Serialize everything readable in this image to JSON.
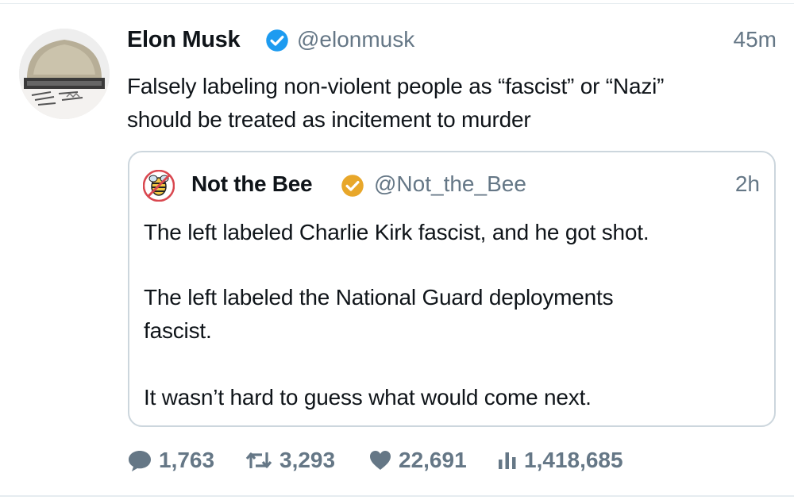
{
  "tweet": {
    "author_name": "Elon Musk",
    "author_handle": "@elonmusk",
    "time": "45m",
    "text_line1": "Falsely labeling non-violent people as “fascist” or “Nazi”",
    "text_line2": "should be treated as incitement to murder",
    "verified_color": "#1d9bf0"
  },
  "quoted_tweet": {
    "author_name": "Not the Bee",
    "author_handle": "@Not_the_Bee",
    "time": "2h",
    "paragraph1": "The left labeled Charlie Kirk fascist, and he got shot.",
    "paragraph2_line1": "The left labeled the National Guard deployments",
    "paragraph2_line2": "fascist.",
    "paragraph3": "It wasn’t hard to guess what would come next.",
    "verified_color": "#e8a72a"
  },
  "actions": {
    "replies": "1,763",
    "retweets": "3,293",
    "likes": "22,691",
    "views": "1,418,685",
    "icons": [
      "comment-icon",
      "retweet-icon",
      "heart-icon",
      "views-icon"
    ]
  },
  "colors": {
    "secondary_text": "#657786",
    "border": "#ccd6dd"
  }
}
